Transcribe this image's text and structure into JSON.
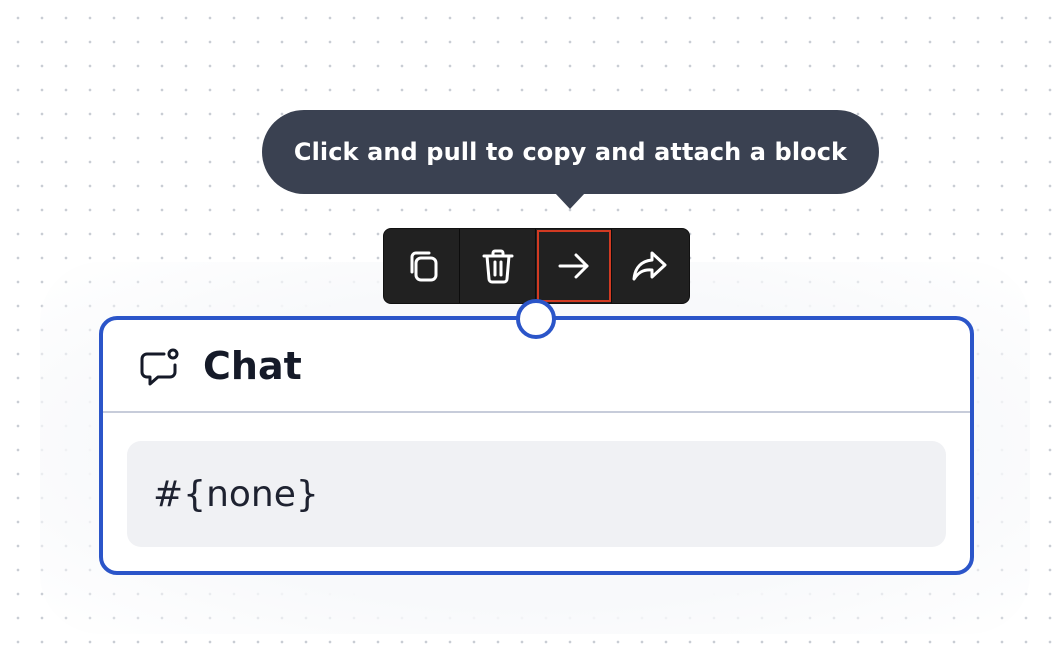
{
  "tooltip": {
    "text": "Click and pull to copy and attach a block"
  },
  "toolbar": {
    "buttons": [
      {
        "name": "duplicate",
        "icon": "copy-icon"
      },
      {
        "name": "delete",
        "icon": "trash-icon"
      },
      {
        "name": "connect",
        "icon": "arrow-right-icon",
        "active": true
      },
      {
        "name": "share",
        "icon": "share-arrow-icon"
      }
    ]
  },
  "block": {
    "icon": "chat-bubble-icon",
    "title": "Chat",
    "value": "#{none}"
  },
  "colors": {
    "accent": "#2b55c9",
    "tooltip_bg": "#3a4151",
    "toolbar_bg": "#212121",
    "active_outline": "#d23a22",
    "field_bg": "#f0f1f4"
  }
}
